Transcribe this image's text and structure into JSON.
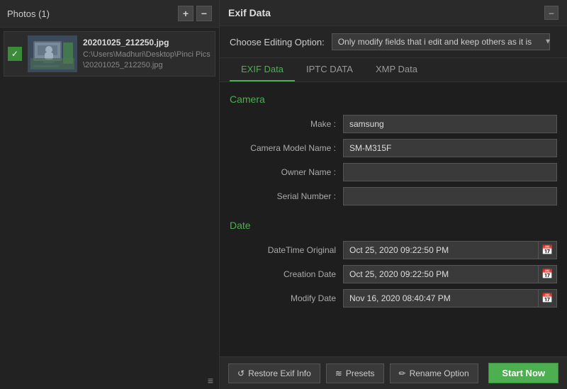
{
  "leftPanel": {
    "title": "Photos (1)",
    "addIcon": "+",
    "removeIcon": "−",
    "photos": [
      {
        "id": 1,
        "name": "20201025_212250.jpg",
        "path": "C:\\Users\\Madhuri\\Desktop\\Pinci Pics\\20201025_212250.jpg",
        "checked": true
      }
    ]
  },
  "rightPanel": {
    "title": "Exif Data",
    "editingOptionLabel": "Choose Editing Option:",
    "editingOptionValue": "Only modify fields that i edit and keep others as it is",
    "tabs": [
      {
        "label": "EXIF Data",
        "active": true
      },
      {
        "label": "IPTC DATA",
        "active": false
      },
      {
        "label": "XMP Data",
        "active": false
      }
    ],
    "sections": {
      "camera": {
        "title": "Camera",
        "fields": [
          {
            "label": "Make :",
            "value": "samsung",
            "type": "text"
          },
          {
            "label": "Camera Model Name :",
            "value": "SM-M315F",
            "type": "text"
          },
          {
            "label": "Owner Name :",
            "value": "",
            "type": "text"
          },
          {
            "label": "Serial Number :",
            "value": "",
            "type": "text"
          }
        ]
      },
      "date": {
        "title": "Date",
        "fields": [
          {
            "label": "DateTime Original",
            "value": "Oct 25, 2020 09:22:50 PM",
            "type": "date"
          },
          {
            "label": "Creation Date",
            "value": "Oct 25, 2020 09:22:50 PM",
            "type": "date"
          },
          {
            "label": "Modify Date",
            "value": "Nov 16, 2020 08:40:47 PM",
            "type": "date"
          }
        ]
      }
    }
  },
  "bottomBar": {
    "restoreLabel": "Restore Exif Info",
    "presetsLabel": "Presets",
    "renameLabel": "Rename Option",
    "startLabel": "Start Now"
  }
}
